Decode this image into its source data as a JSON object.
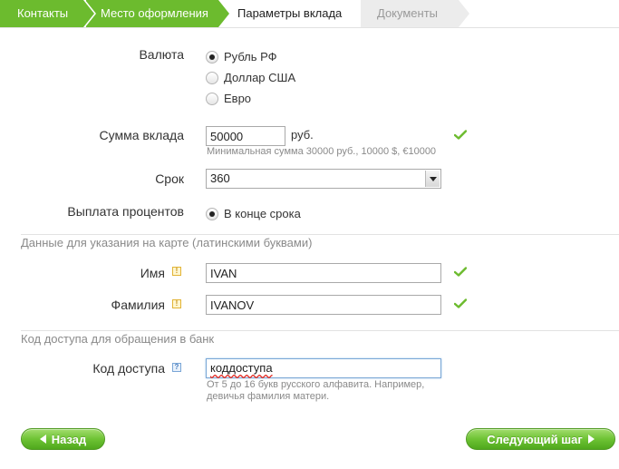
{
  "tabs": [
    {
      "label": "Контакты",
      "state": "done"
    },
    {
      "label": "Место оформления",
      "state": "done"
    },
    {
      "label": "Параметры вклада",
      "state": "active"
    },
    {
      "label": "Документы",
      "state": "future"
    }
  ],
  "currency": {
    "label": "Валюта",
    "options": [
      "Рубль РФ",
      "Доллар США",
      "Евро"
    ],
    "selected": "Рубль РФ"
  },
  "amount": {
    "label": "Сумма вклада",
    "value": "50000",
    "unit": "руб.",
    "hint": "Минимальная сумма 30000 руб., 10000 $, €10000"
  },
  "term": {
    "label": "Срок",
    "value": "360"
  },
  "payout": {
    "label": "Выплата процентов",
    "options": [
      "В конце срока"
    ],
    "selected": "В конце срока"
  },
  "card_section": {
    "title": "Данные для указания на карте (латинскими буквами)",
    "first_name": {
      "label": "Имя",
      "value": "IVAN"
    },
    "last_name": {
      "label": "Фамилия",
      "value": "IVANOV"
    }
  },
  "access_section": {
    "title": "Код доступа для обращения в банк",
    "code": {
      "label": "Код доступа",
      "value": "коддоступа",
      "hint_line1": "От 5 до 16 букв русского алфавита. Например,",
      "hint_line2": "девичья фамилия матери."
    }
  },
  "buttons": {
    "back": "Назад",
    "next": "Следующий шаг"
  },
  "colors": {
    "tab_done": "#6cbb2e",
    "check": "#6cbb2e",
    "button_green": "#6ec334"
  }
}
